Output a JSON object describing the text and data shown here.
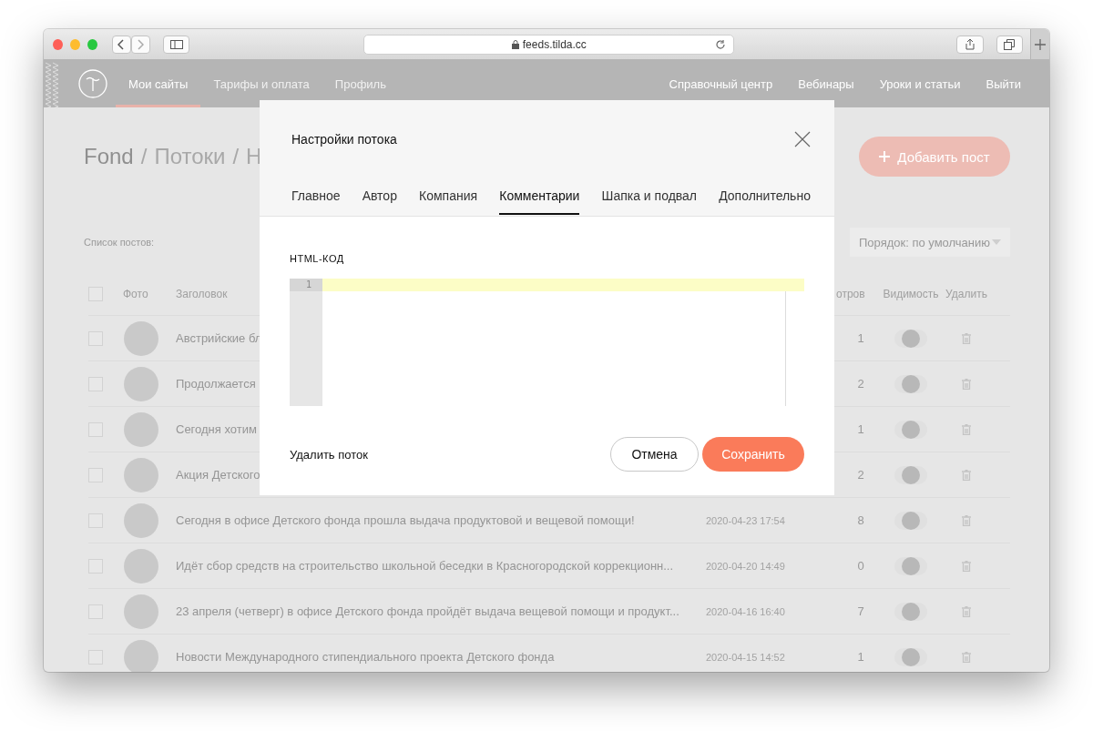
{
  "browser": {
    "url": "feeds.tilda.cc"
  },
  "nav": {
    "items": [
      {
        "label": "Мои сайты",
        "selected": true
      },
      {
        "label": "Тарифы и оплата",
        "selected": false
      },
      {
        "label": "Профиль",
        "selected": false
      }
    ],
    "right_items": [
      "Справочный центр",
      "Вебинары",
      "Уроки и статьи",
      "Выйти"
    ]
  },
  "page": {
    "breadcrumb": [
      "Fond",
      "/",
      "Потоки",
      "/",
      "Н"
    ],
    "add_button": "Добавить пост",
    "list_label": "Список постов:",
    "sort": "Порядок: по умолчанию"
  },
  "table": {
    "all_checked": false,
    "columns": [
      "Фото",
      "Заголовок",
      "отров",
      "Видимость",
      "Удалить"
    ],
    "rows": [
      {
        "checked": false,
        "title": "Австрийские бл",
        "views": "1",
        "visible": true
      },
      {
        "checked": false,
        "title": "Продолжается",
        "views": "2",
        "visible": true
      },
      {
        "checked": false,
        "title": "Сегодня хотим",
        "views": "1",
        "visible": true
      },
      {
        "checked": false,
        "title": "Акция Детского",
        "views": "2",
        "visible": true
      },
      {
        "checked": false,
        "title": "Сегодня в офисе Детского фонда прошла выдача продуктовой и вещевой помощи!",
        "date": "2020-04-23 17:54",
        "views": "8",
        "visible": true
      },
      {
        "checked": false,
        "title": "Идёт сбор средств на строительство школьной беседки в Красногородской коррекционн...",
        "date": "2020-04-20 14:49",
        "views": "0",
        "visible": true
      },
      {
        "checked": false,
        "title": "23 апреля (четверг) в офисе Детского фонда пройдёт выдача вещевой помощи и продукт...",
        "date": "2020-04-16 16:40",
        "views": "7",
        "visible": true
      },
      {
        "checked": false,
        "title": "Новости Международного стипендиального проекта Детского фонда",
        "date": "2020-04-15 14:52",
        "views": "1",
        "visible": true
      }
    ]
  },
  "modal": {
    "title": "Настройки потока",
    "tabs": [
      {
        "label": "Главное",
        "selected": false
      },
      {
        "label": "Автор",
        "selected": false
      },
      {
        "label": "Компания",
        "selected": false
      },
      {
        "label": "Комментарии",
        "selected": true
      },
      {
        "label": "Шапка и подвал",
        "selected": false
      },
      {
        "label": "Дополнительно",
        "selected": false
      }
    ],
    "field_label": "HTML-КОД",
    "line_numbers": [
      "1"
    ],
    "delete_link": "Удалить поток",
    "cancel": "Отмена",
    "save": "Сохранить"
  }
}
